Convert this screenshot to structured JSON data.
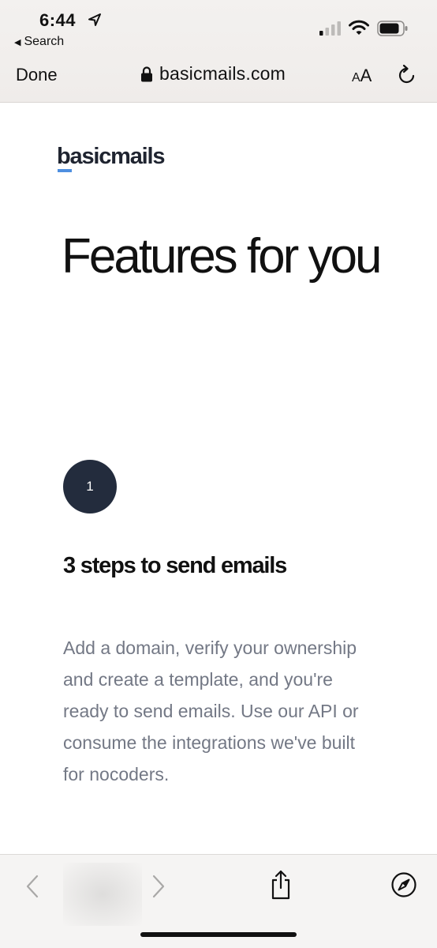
{
  "status_bar": {
    "time": "6:44",
    "back_app_label": "Search"
  },
  "browser": {
    "done_label": "Done",
    "url": "basicmails.com",
    "text_size_label_small": "A",
    "text_size_label_large": "A"
  },
  "page": {
    "logo": "basicmails",
    "hero_title": "Features for you",
    "step_number": "1",
    "feature_title": "3 steps to send emails",
    "feature_description": "Add a domain, verify your ownership and create a template, and you're ready to send emails. Use our API or consume the integrations we've built for nocoders."
  },
  "colors": {
    "accent": "#4e8fe0",
    "step_circle": "#232c3d",
    "body_text": "#737885"
  },
  "icons": {
    "location": "location-arrow-icon",
    "signal": "cellular-signal-icon",
    "wifi": "wifi-icon",
    "battery": "battery-icon",
    "lock": "lock-icon",
    "reload": "reload-icon",
    "back": "chevron-left-icon",
    "forward": "chevron-right-icon",
    "share": "share-icon",
    "compass": "compass-icon"
  }
}
